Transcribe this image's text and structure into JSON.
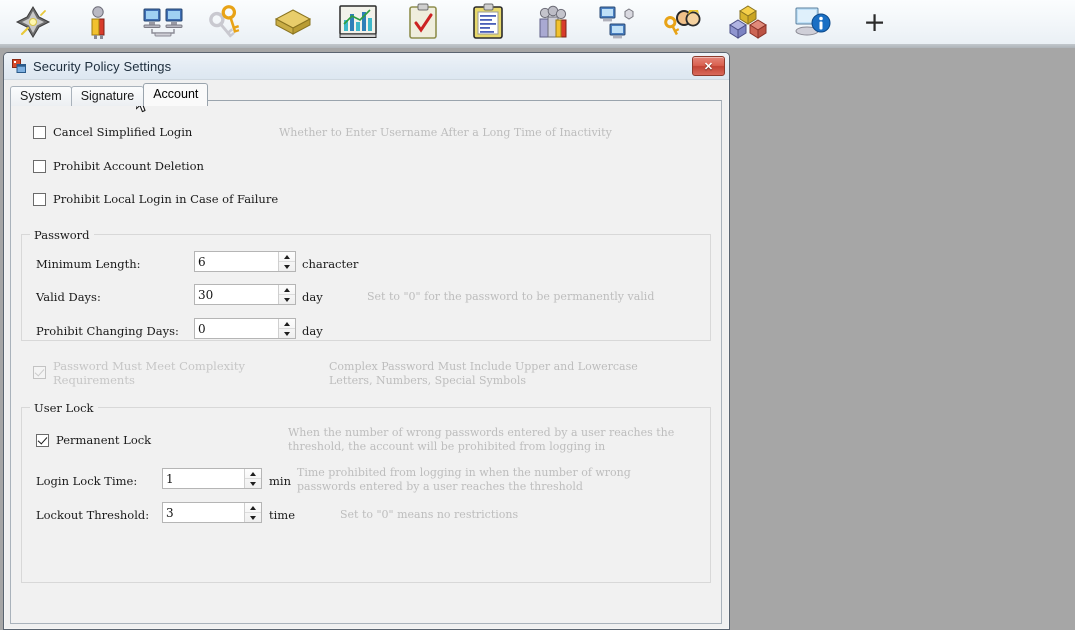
{
  "toolbar": {
    "icons": [
      {
        "name": "wizard-sparkle-icon",
        "label": "Wizard"
      },
      {
        "name": "user-person-icon",
        "label": "User"
      },
      {
        "name": "network-computers-icon",
        "label": "Network"
      },
      {
        "name": "keys-permission-icon",
        "label": "Permissions"
      },
      {
        "name": "package-box-icon",
        "label": "Package"
      },
      {
        "name": "bar-chart-monitor-icon",
        "label": "Statistics"
      },
      {
        "name": "clipboard-check-icon",
        "label": "Tasks"
      },
      {
        "name": "clipboard-document-icon",
        "label": "Records"
      },
      {
        "name": "user-group-icon",
        "label": "Groups"
      },
      {
        "name": "device-sync-icon",
        "label": "Devices"
      },
      {
        "name": "key-user-icon",
        "label": "Account Keys"
      },
      {
        "name": "color-blocks-icon",
        "label": "Modules"
      },
      {
        "name": "monitor-info-icon",
        "label": "Information"
      }
    ],
    "add_label": "+"
  },
  "dialog": {
    "title": "Security Policy Settings",
    "title_icon": "app-window-icon",
    "close_label": "✕",
    "tabs": [
      {
        "label": "System",
        "active": false
      },
      {
        "label": "Signature",
        "active": false
      },
      {
        "label": "Account",
        "active": true
      }
    ]
  },
  "account": {
    "checkboxes": [
      {
        "label": "Cancel Simplified Login",
        "checked": false,
        "enabled": true,
        "hint": "Whether to Enter Username After a Long Time of Inactivity"
      },
      {
        "label": "Prohibit Account Deletion",
        "checked": false,
        "enabled": true,
        "hint": ""
      },
      {
        "label": "Prohibit Local Login in Case of Failure",
        "checked": false,
        "enabled": true,
        "hint": ""
      }
    ],
    "password_group": {
      "title": "Password",
      "fields": [
        {
          "label": "Minimum Length:",
          "value": "6",
          "unit": "character",
          "hint": ""
        },
        {
          "label": "Valid Days:",
          "value": "30",
          "unit": "day",
          "hint": "Set to \"0\" for the password to be permanently valid"
        },
        {
          "label": "Prohibit Changing Days:",
          "value": "0",
          "unit": "day",
          "hint": ""
        }
      ],
      "complexity": {
        "label": "Password Must Meet Complexity\nRequirements",
        "checked": true,
        "enabled": false,
        "hint": "Complex Password Must Include Upper and Lowercase\nLetters, Numbers, Special Symbols"
      }
    },
    "user_lock_group": {
      "title": "User Lock",
      "permanent_lock": {
        "label": "Permanent Lock",
        "checked": true,
        "enabled": true,
        "hint": "When the number of wrong passwords entered by a user reaches the\nthreshold, the account will be prohibited from logging in"
      },
      "fields": [
        {
          "label": "Login Lock Time:",
          "value": "1",
          "unit": "min",
          "hint": "Time prohibited from logging in when the number of wrong\npasswords entered by a user reaches the threshold"
        },
        {
          "label": "Lockout Threshold:",
          "value": "3",
          "unit": "time",
          "hint": "Set to \"0\" means no restrictions"
        }
      ]
    }
  },
  "colors": {
    "desktop_background": "#a6a6a6",
    "dialog_background": "#f0f0f0",
    "panel_background": "#f1f1f1",
    "close_button": "#c24334",
    "hint_text": "#bdbdbd",
    "body_text": "#1a1a1a"
  }
}
